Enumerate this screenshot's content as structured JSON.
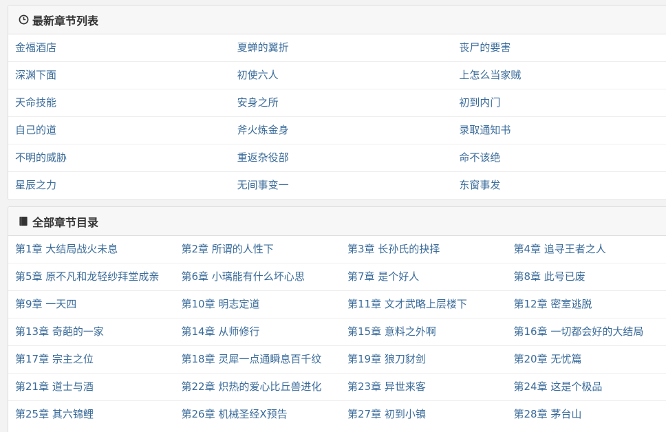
{
  "latest": {
    "title": "最新章节列表",
    "items": [
      [
        "金福酒店",
        "夏蝉的翼折",
        "丧尸的要害"
      ],
      [
        "深渊下面",
        "初使六人",
        "上怎么当家贼"
      ],
      [
        "天命技能",
        "安身之所",
        "初到内门"
      ],
      [
        "自己的道",
        "斧火炼金身",
        "录取通知书"
      ],
      [
        "不明的威胁",
        "重返杂役部",
        "命不该绝"
      ],
      [
        "星辰之力",
        "无间事变一",
        "东窗事发"
      ]
    ]
  },
  "all": {
    "title": "全部章节目录",
    "items": [
      [
        "第1章 大结局战火未息",
        "第2章 所谓的人性下",
        "第3章 长孙氏的抉择",
        "第4章 追寻王者之人"
      ],
      [
        "第5章 原不凡和龙轻纱拜堂成亲",
        "第6章 小璃能有什么坏心思",
        "第7章 是个好人",
        "第8章 此号已废"
      ],
      [
        "第9章 一天四",
        "第10章 明志定道",
        "第11章 文才武略上层楼下",
        "第12章 密室逃脱"
      ],
      [
        "第13章 奇葩的一家",
        "第14章 从师修行",
        "第15章 意料之外啊",
        "第16章 一切都会好的大结局"
      ],
      [
        "第17章 宗主之位",
        "第18章 灵犀一点通瞬息百千纹",
        "第19章 狼刀豺剑",
        "第20章 无忧篇"
      ],
      [
        "第21章 道士与酒",
        "第22章 炽热的爱心比丘兽进化",
        "第23章 异世来客",
        "第24章 这是个极品"
      ],
      [
        "第25章 其六锦鲤",
        "第26章 机械圣经X预告",
        "第27章 初到小镇",
        "第28章 茅台山"
      ]
    ]
  },
  "icons": {
    "latest": "clock-icon",
    "all": "book-icon"
  },
  "colors": {
    "link": "#3a6b9a",
    "title": "#333333"
  }
}
